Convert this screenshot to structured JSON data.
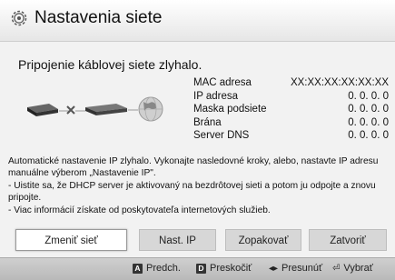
{
  "header": {
    "title": "Nastavenia siete",
    "icon": "gear-icon"
  },
  "status_text": "Pripojenie káblovej siete zlyhalo.",
  "diagram": {
    "icons": [
      "player-icon",
      "failed-link-icon",
      "router-icon",
      "globe-icon"
    ]
  },
  "network_info": {
    "labels": [
      "MAC adresa",
      "IP adresa",
      "Maska podsiete",
      "Brána",
      "Server DNS"
    ],
    "values": [
      "XX:XX:XX:XX:XX:XX",
      "0.  0.  0.  0",
      "0.  0.  0.  0",
      "0.  0.  0.  0",
      "0.  0.  0.  0"
    ]
  },
  "message_lines": [
    "Automatické nastavenie IP zlyhalo. Vykonajte nasledovné kroky, alebo, nastavte IP adresu",
    "manuálne výberom „Nastavenie IP\".",
    "- Uistite sa, že DHCP server je aktivovaný na bezdrôtovej sieti a potom ju odpojte a znovu",
    "pripojte.",
    "- Viac informácií získate od poskytovateľa internetových služieb."
  ],
  "buttons": {
    "change_network": "Zmeniť sieť",
    "ip_settings": "Nast. IP",
    "retry": "Zopakovať",
    "close": "Zatvoriť",
    "selected": "change_network"
  },
  "footer": {
    "previous": {
      "key": "A",
      "label": "Predch."
    },
    "skip": {
      "key": "D",
      "label": "Preskočiť"
    },
    "move": {
      "key": "◂▸",
      "label": "Presunúť"
    },
    "select": {
      "key": "⏎",
      "label": "Vybrať"
    }
  },
  "colors": {
    "selected_button": "#ffffff",
    "button": "#d7d7d7",
    "footer": "#c4c4c4",
    "background": "#f2f2f2"
  }
}
